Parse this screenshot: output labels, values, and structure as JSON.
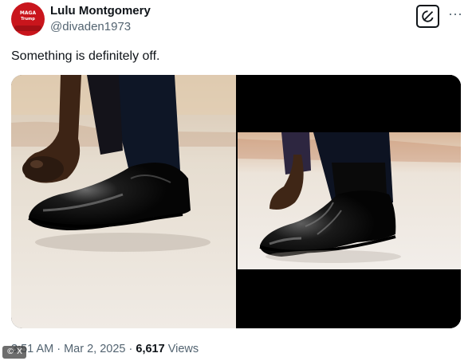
{
  "author": {
    "display_name": "Lulu Montgomery",
    "handle": "@divaden1973",
    "avatar_icon": "red-maga-hat-avatar",
    "avatar_text": "MAGA"
  },
  "actions": {
    "grok_icon": "grok-icon",
    "more_label": "···"
  },
  "tweet": {
    "text": "Something is definitely off."
  },
  "media": {
    "left_image": "close-up of black patent leather shoes on a carpet",
    "right_image": "black dress shoe with bunched leather and dark trousers on a carpet"
  },
  "meta": {
    "time": "3:51 AM",
    "sep1": " · ",
    "date": "Mar 2, 2025",
    "sep2": " · ",
    "views_count": "6,617",
    "views_label": " Views"
  },
  "watermark": {
    "label": "© X"
  },
  "colors": {
    "text_primary": "#0f1419",
    "text_secondary": "#536471",
    "avatar_red": "#c9151c"
  }
}
